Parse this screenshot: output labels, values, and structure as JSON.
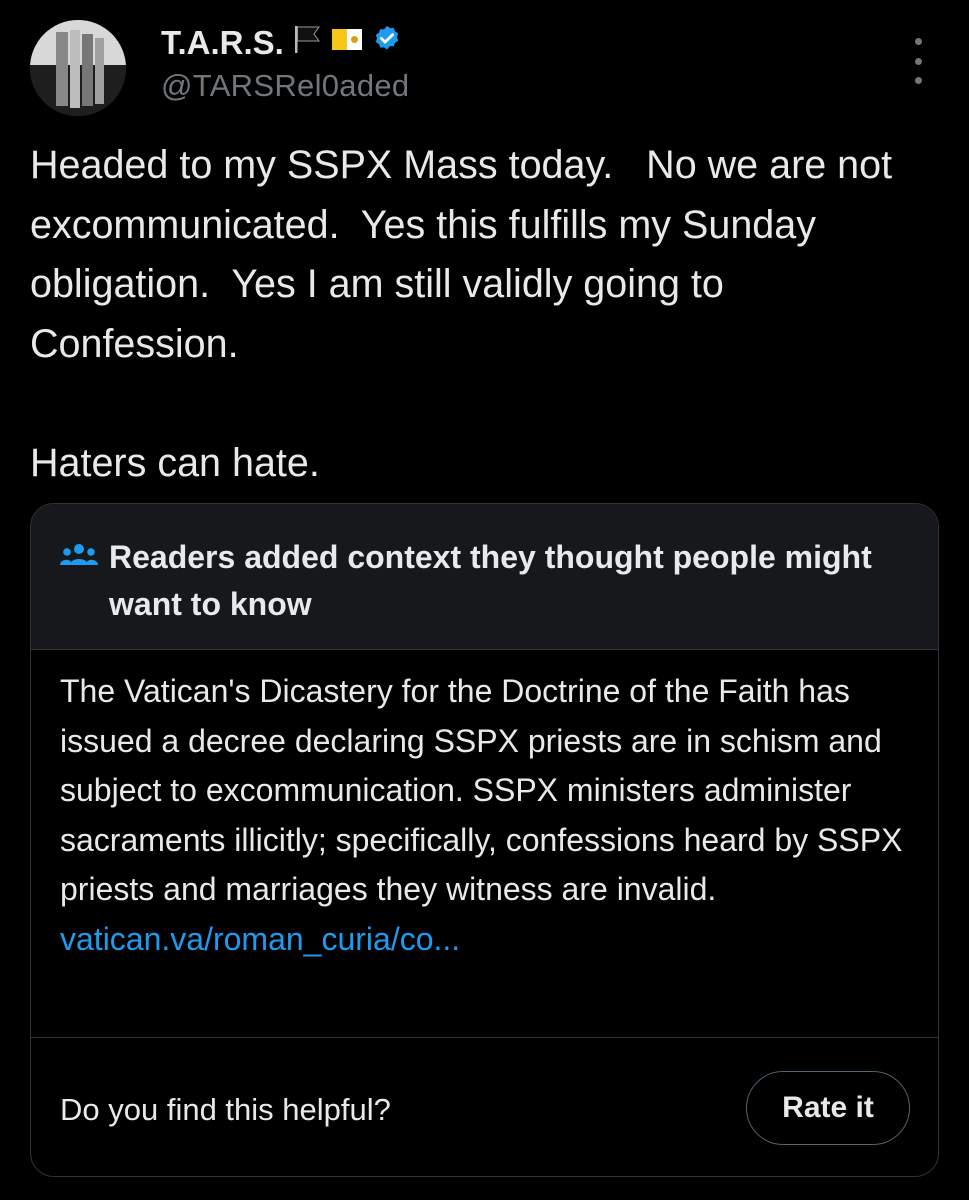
{
  "user": {
    "display_name": "T.A.R.S.",
    "handle": "@TARSRel0aded",
    "flag_icon": "black-flag-icon",
    "vatican_icon": "vatican-flag-icon",
    "verified_icon": "verified-badge-icon",
    "verified_color": "#1d9bf0"
  },
  "tweet": {
    "text": "Headed to my SSPX Mass today.   No we are not excommunicated.  Yes this fulfills my Sunday obligation.  Yes I am still validly going to Confession.\n\nHaters can hate."
  },
  "community_note": {
    "title": "Readers added context they thought people might want to know",
    "icon": "people-icon",
    "body": "The Vatican's Dicastery for the Doctrine of the Faith has issued a decree declaring SSPX priests are in schism and subject to excommunication. SSPX ministers administer sacraments illicitly; specifically, confessions heard by SSPX priests and marriages they witness are invalid.",
    "link_text": "vatican.va/roman_curia/co...",
    "link_color": "#1d9bf0",
    "helpful_question": "Do you find this helpful?",
    "rate_label": "Rate it"
  }
}
